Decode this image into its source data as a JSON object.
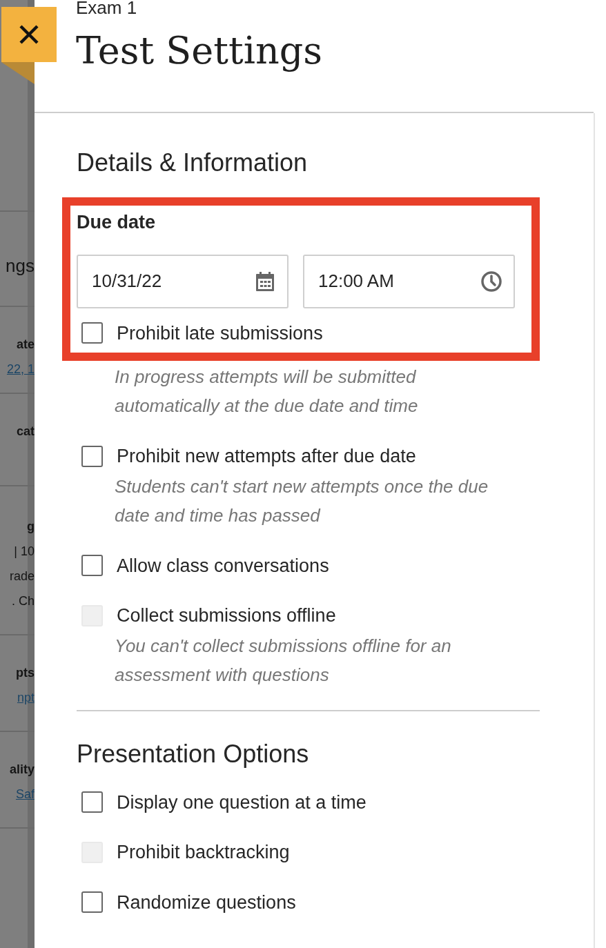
{
  "background_page": [
    {
      "kind": "heading",
      "text": "ngs"
    },
    {
      "kind": "label",
      "text": "ate"
    },
    {
      "kind": "link",
      "text": "22, 1"
    },
    {
      "kind": "label",
      "text": "cat"
    },
    {
      "kind": "label",
      "text": "g"
    },
    {
      "kind": "text",
      "text": "| 10"
    },
    {
      "kind": "text",
      "text": "rade"
    },
    {
      "kind": "text",
      "text": ". Ch"
    },
    {
      "kind": "label",
      "text": "pts"
    },
    {
      "kind": "link",
      "text": "npt"
    },
    {
      "kind": "label",
      "text": "ality"
    },
    {
      "kind": "link",
      "text": "Saf"
    }
  ],
  "header": {
    "eyebrow": "Exam 1",
    "title": "Test Settings"
  },
  "sections": [
    {
      "title": "Details & Information",
      "due_date": {
        "label": "Due date",
        "date": "10/31/22",
        "time": "12:00 AM",
        "highlighted": true
      },
      "options": [
        {
          "label": "Prohibit late submissions",
          "checked": false,
          "disabled": false,
          "description": "In progress attempts will be submitted automatically at the due date and time"
        },
        {
          "label": "Prohibit new attempts after due date",
          "checked": false,
          "disabled": false,
          "description": "Students can't start new attempts once the due date and time has passed"
        },
        {
          "label": "Allow class conversations",
          "checked": false,
          "disabled": false
        },
        {
          "label": "Collect submissions offline",
          "checked": false,
          "disabled": true,
          "description": "You can't collect submissions offline for an assessment with questions"
        }
      ]
    },
    {
      "title": "Presentation Options",
      "options": [
        {
          "label": "Display one question at a time",
          "checked": false,
          "disabled": false
        },
        {
          "label": "Prohibit backtracking",
          "checked": false,
          "disabled": true
        },
        {
          "label": "Randomize questions",
          "checked": false,
          "disabled": false
        }
      ]
    }
  ]
}
